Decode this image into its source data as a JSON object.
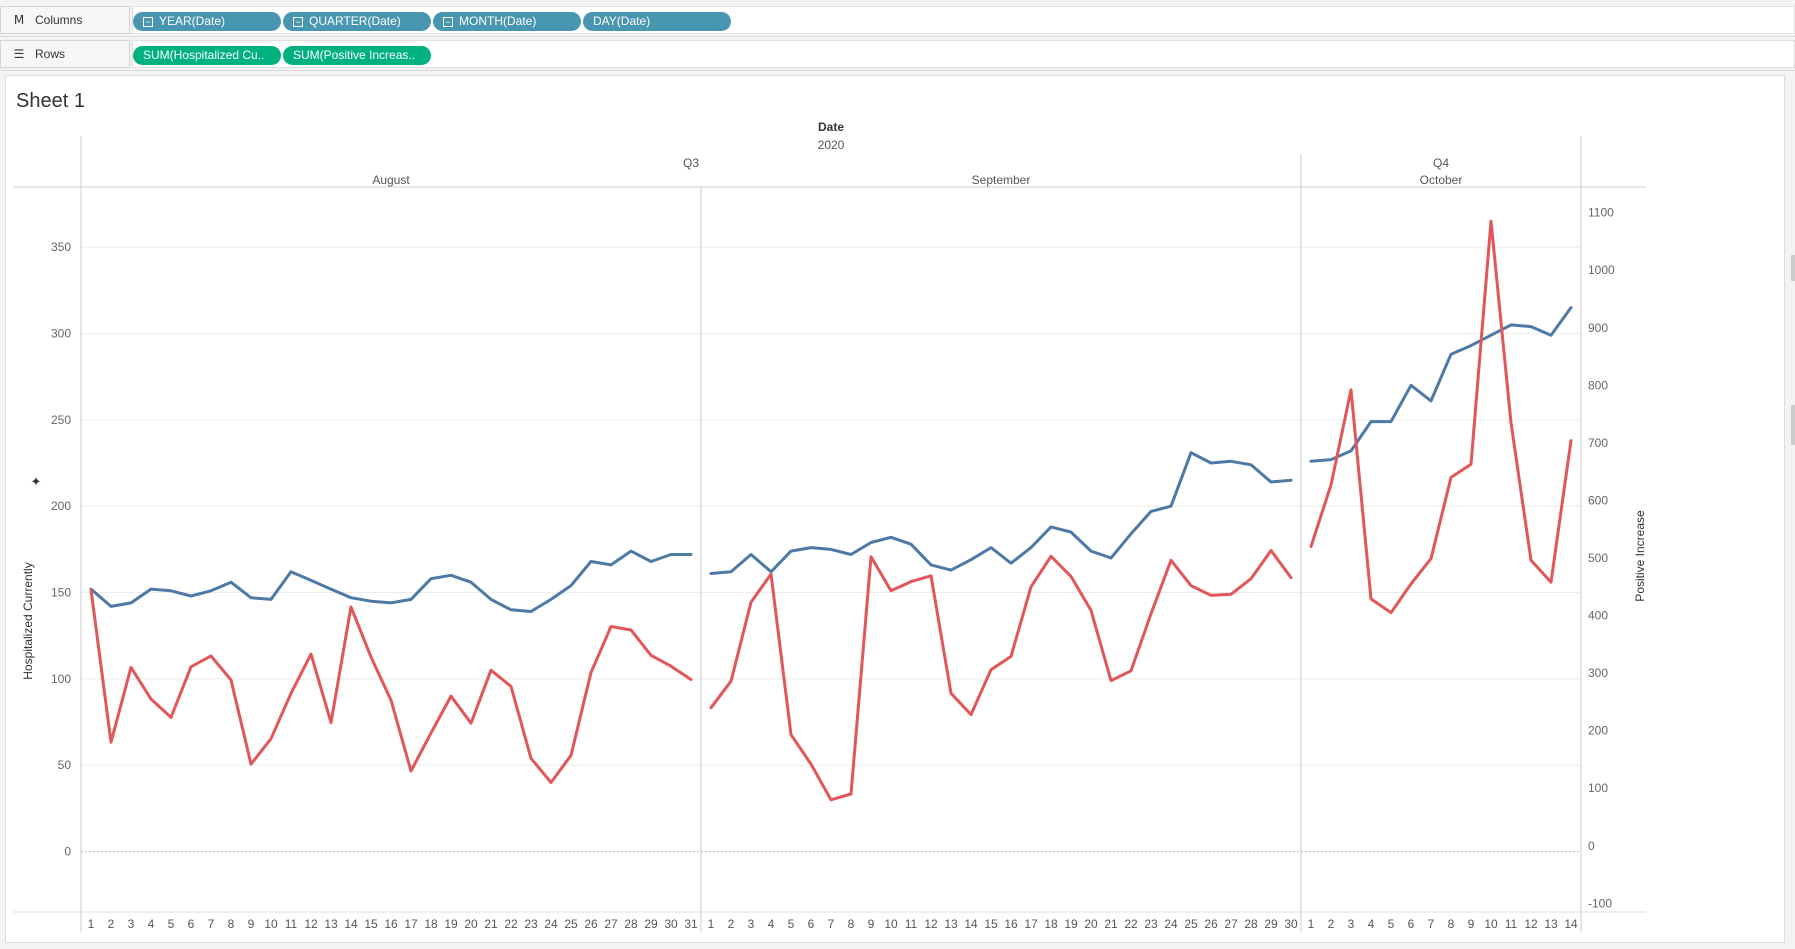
{
  "shelves": {
    "columns": {
      "label": "Columns",
      "icon": "columns-icon",
      "pills": [
        {
          "label": "YEAR(Date)",
          "collapse": true
        },
        {
          "label": "QUARTER(Date)",
          "collapse": true
        },
        {
          "label": "MONTH(Date)",
          "collapse": true
        },
        {
          "label": "DAY(Date)",
          "collapse": false
        }
      ]
    },
    "rows": {
      "label": "Rows",
      "icon": "rows-icon",
      "pills": [
        {
          "label": "SUM(Hospitalized Cu.."
        },
        {
          "label": "SUM(Positive Increas.."
        }
      ]
    }
  },
  "sheet": {
    "title": "Sheet 1"
  },
  "colors": {
    "hospitalized": "#4e79a7",
    "positive": "#e15759",
    "pill_blue": "#4996b2",
    "pill_green": "#00b180"
  },
  "chart_data": {
    "type": "line",
    "header": {
      "field": "Date",
      "year": "2020",
      "quarters": [
        "Q3",
        "Q4"
      ]
    },
    "panels": [
      {
        "month": "August",
        "quarter": "Q3",
        "days": [
          "1",
          "2",
          "3",
          "4",
          "5",
          "6",
          "7",
          "8",
          "9",
          "10",
          "11",
          "12",
          "13",
          "14",
          "15",
          "16",
          "17",
          "18",
          "19",
          "20",
          "21",
          "22",
          "23",
          "24",
          "25",
          "26",
          "27",
          "28",
          "29",
          "30",
          "31"
        ]
      },
      {
        "month": "September",
        "quarter": "Q3",
        "days": [
          "1",
          "2",
          "3",
          "4",
          "5",
          "6",
          "7",
          "8",
          "9",
          "10",
          "11",
          "12",
          "13",
          "14",
          "15",
          "16",
          "17",
          "18",
          "19",
          "20",
          "21",
          "22",
          "23",
          "24",
          "25",
          "26",
          "27",
          "28",
          "29",
          "30"
        ]
      },
      {
        "month": "October",
        "quarter": "Q4",
        "days": [
          "1",
          "2",
          "3",
          "4",
          "5",
          "6",
          "7",
          "8",
          "9",
          "10",
          "11",
          "12",
          "13",
          "14"
        ]
      }
    ],
    "left_axis": {
      "label": "Hospitalized Currently",
      "ylim": [
        -35,
        375
      ],
      "ticks": [
        0,
        50,
        100,
        150,
        200,
        250,
        300,
        350
      ]
    },
    "right_axis": {
      "label": "Positive Increase",
      "ylim": [
        -115,
        1115
      ],
      "ticks": [
        -100,
        0,
        100,
        200,
        300,
        400,
        500,
        600,
        700,
        800,
        900,
        1000,
        1100
      ]
    },
    "series": [
      {
        "axis": "left",
        "color": "#4e79a7",
        "values": [
          [
            152,
            142,
            144,
            152,
            151,
            148,
            151,
            156,
            147,
            146,
            162,
            157,
            152,
            147,
            145,
            144,
            146,
            158,
            160,
            156,
            146,
            140,
            139,
            146,
            154,
            168,
            166,
            174,
            168,
            172,
            172
          ],
          [
            161,
            162,
            172,
            162,
            174,
            176,
            175,
            172,
            179,
            182,
            178,
            166,
            163,
            169,
            176,
            167,
            176,
            188,
            185,
            174,
            170,
            184,
            197,
            200,
            231,
            225,
            226,
            224,
            214,
            215
          ],
          [
            226,
            227,
            232,
            249,
            249,
            270,
            261,
            288,
            293,
            299,
            305,
            304,
            299,
            315
          ]
        ]
      },
      {
        "axis": "right",
        "color": "#e15759",
        "values": [
          [
            445,
            180,
            310,
            255,
            223,
            311,
            330,
            288,
            142,
            186,
            265,
            333,
            214,
            415,
            328,
            253,
            130,
            196,
            260,
            213,
            305,
            277,
            152,
            110,
            157,
            301,
            381,
            375,
            331,
            312,
            289
          ],
          [
            240,
            286,
            423,
            472,
            193,
            142,
            80,
            90,
            502,
            443,
            459,
            469,
            265,
            228,
            306,
            329,
            450,
            503,
            468,
            409,
            287,
            304,
            403,
            496,
            452,
            435,
            437,
            464,
            513,
            466
          ],
          [
            520,
            627,
            792,
            429,
            405,
            455,
            499,
            640,
            663,
            1085,
            735,
            496,
            458,
            704
          ]
        ]
      }
    ],
    "grid": true,
    "zero_line": true
  }
}
